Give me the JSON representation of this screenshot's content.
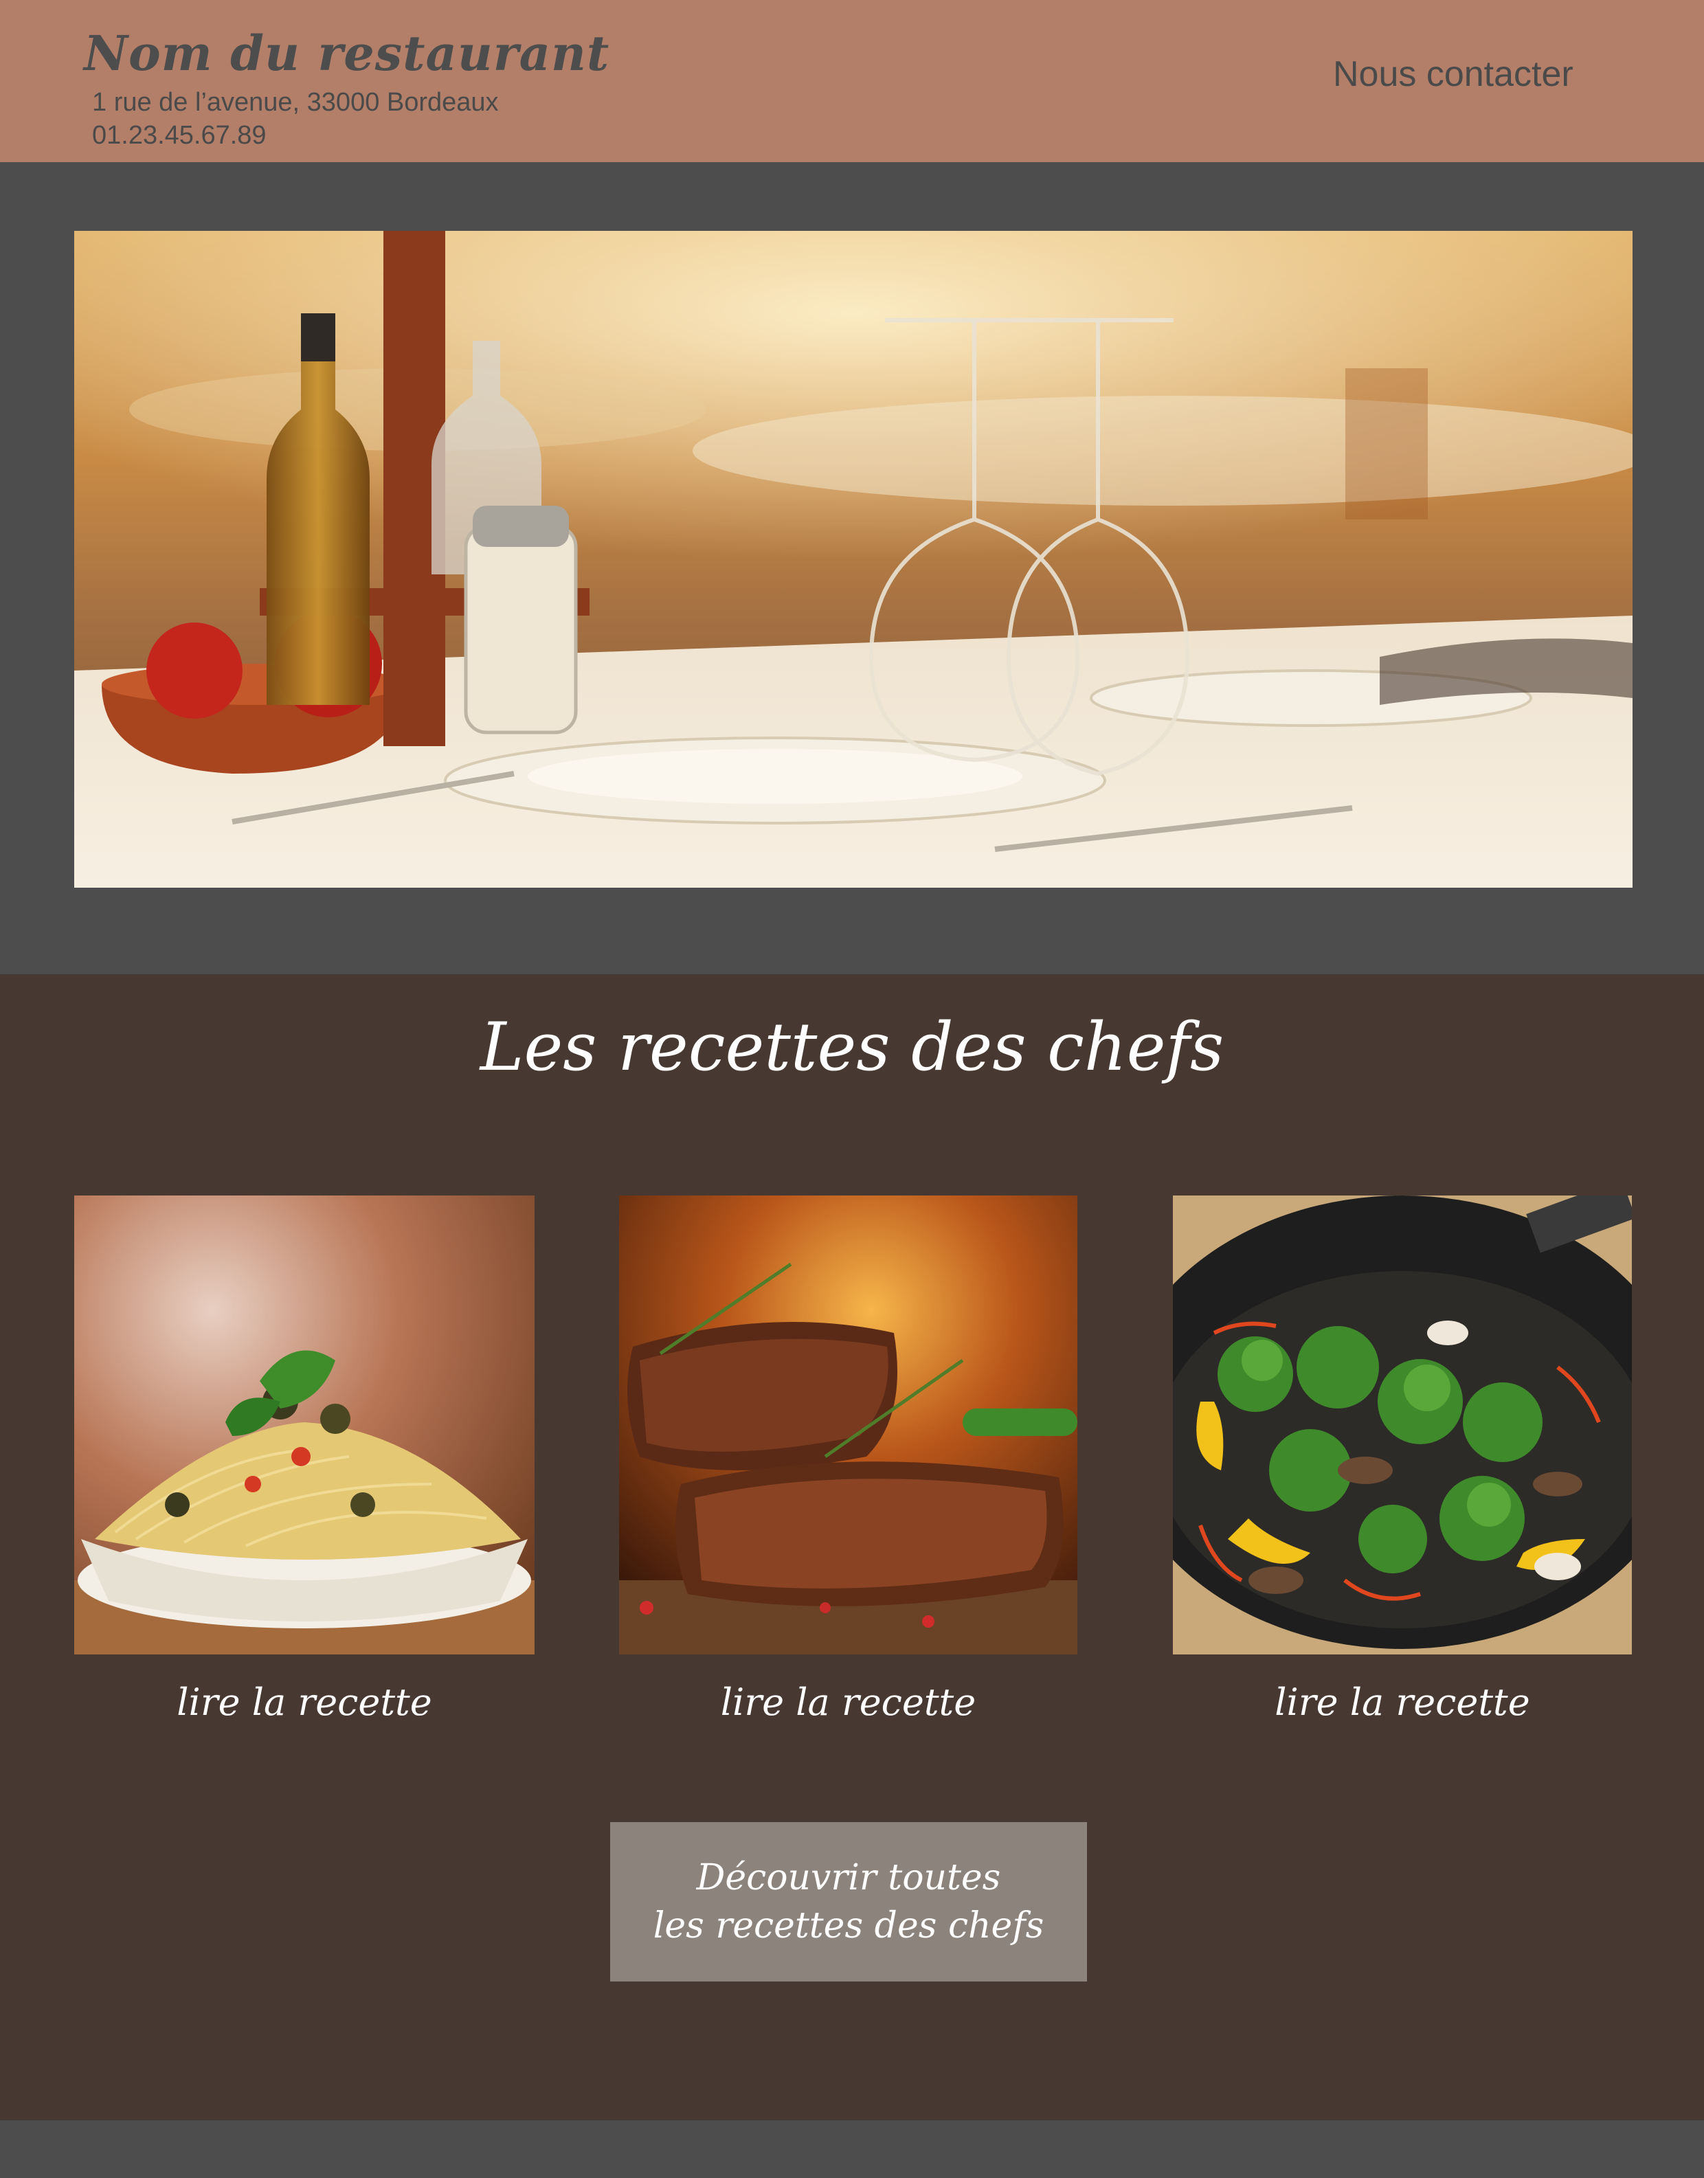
{
  "header": {
    "restaurant_name": "Nom du restaurant",
    "address": "1 rue de l’avenue, 33000 Bordeaux",
    "phone": "01.23.45.67.89",
    "contact_label": "Nous contacter"
  },
  "hero": {
    "image": "restaurant-table-photo"
  },
  "recipes": {
    "title": "Les recettes des chefs",
    "cards": [
      {
        "image": "spaghetti-plate-photo",
        "link_label": "lire la recette"
      },
      {
        "image": "grilled-steak-photo",
        "link_label": "lire la recette"
      },
      {
        "image": "vegetable-wok-photo",
        "link_label": "lire la recette"
      }
    ],
    "discover_button": {
      "line1": "Découvrir toutes",
      "line2": "les recettes des chefs"
    }
  },
  "colors": {
    "header_bg": "#b47f69",
    "hero_band_bg": "#4d4d4d",
    "section_bg": "#473832",
    "button_bg": "#8d837d",
    "text_dark": "#4a4a4a",
    "text_light": "#ffffff"
  }
}
